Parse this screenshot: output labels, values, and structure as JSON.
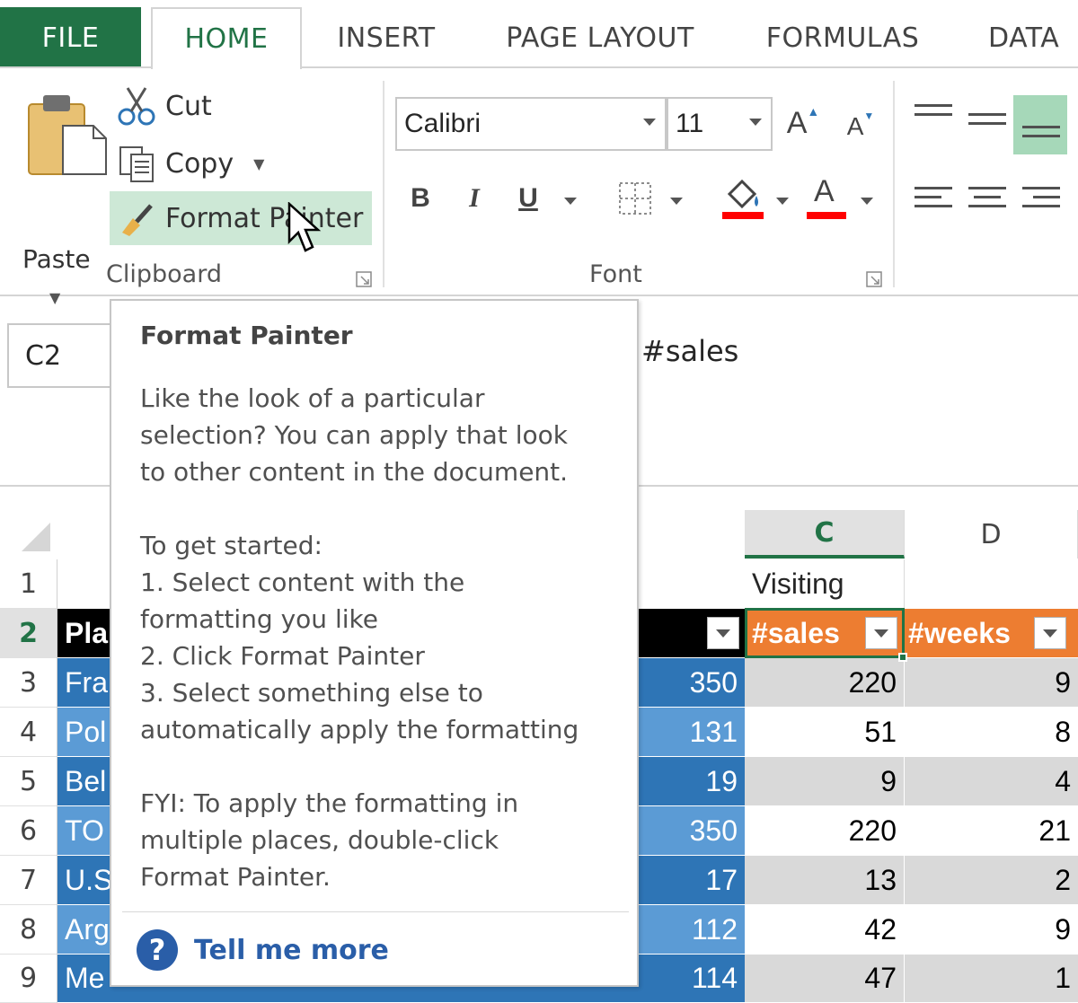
{
  "tabs": {
    "file": "FILE",
    "home": "HOME",
    "insert": "INSERT",
    "page_layout": "PAGE LAYOUT",
    "formulas": "FORMULAS",
    "data": "DATA"
  },
  "clipboard": {
    "paste_label": "Paste",
    "cut_label": "Cut",
    "copy_label": "Copy",
    "format_painter_label": "Format Painter",
    "group_label": "Clipboard"
  },
  "font": {
    "name": "Calibri",
    "size": "11",
    "bold_label": "B",
    "italic_label": "I",
    "underline_label": "U",
    "grow_label": "A",
    "shrink_label": "A",
    "font_color_label": "A",
    "highlight_color": "#ff0000",
    "group_label": "Font"
  },
  "formula_bar": {
    "cell_ref": "C2",
    "formula": "#sales"
  },
  "grid": {
    "columns": [
      "C",
      "D"
    ],
    "selected_column": "C",
    "rows": [
      "1",
      "2",
      "3",
      "4",
      "5",
      "6",
      "7",
      "8",
      "9"
    ],
    "selected_row": "2",
    "c1": "Visiting",
    "header_a_partial": "Pla",
    "header_c": "#sales",
    "header_d": "#weeks",
    "a_partial": [
      "Fra",
      "Pol",
      "Bel",
      "TO",
      "U.S",
      "Arg",
      "Me"
    ],
    "b_values": [
      "350",
      "131",
      "19",
      "350",
      "17",
      "112",
      "114"
    ],
    "c_values": [
      "220",
      "51",
      "9",
      "220",
      "13",
      "42",
      "47"
    ],
    "d_values": [
      "9",
      "8",
      "4",
      "21",
      "2",
      "9",
      "1"
    ],
    "colors": {
      "header_black": "#000000",
      "header_orange": "#ed7d31",
      "blue_dark": "#2e75b6",
      "blue_light": "#5b9bd5",
      "gray_band": "#d9d9d9",
      "accent_green": "#217346"
    }
  },
  "tooltip": {
    "title": "Format Painter",
    "desc_lines": [
      "Like the look of a particular",
      "selection? You can apply that look",
      "to other content in the document."
    ],
    "start_lines": [
      "To get started:",
      "1. Select content with the",
      "formatting you like",
      "2. Click Format Painter",
      "3. Select something else to",
      "automatically apply the formatting"
    ],
    "fyi_lines": [
      "FYI: To apply the formatting in",
      "multiple places, double-click",
      "Format Painter."
    ],
    "more_label": "Tell me more",
    "help_icon_glyph": "?"
  }
}
